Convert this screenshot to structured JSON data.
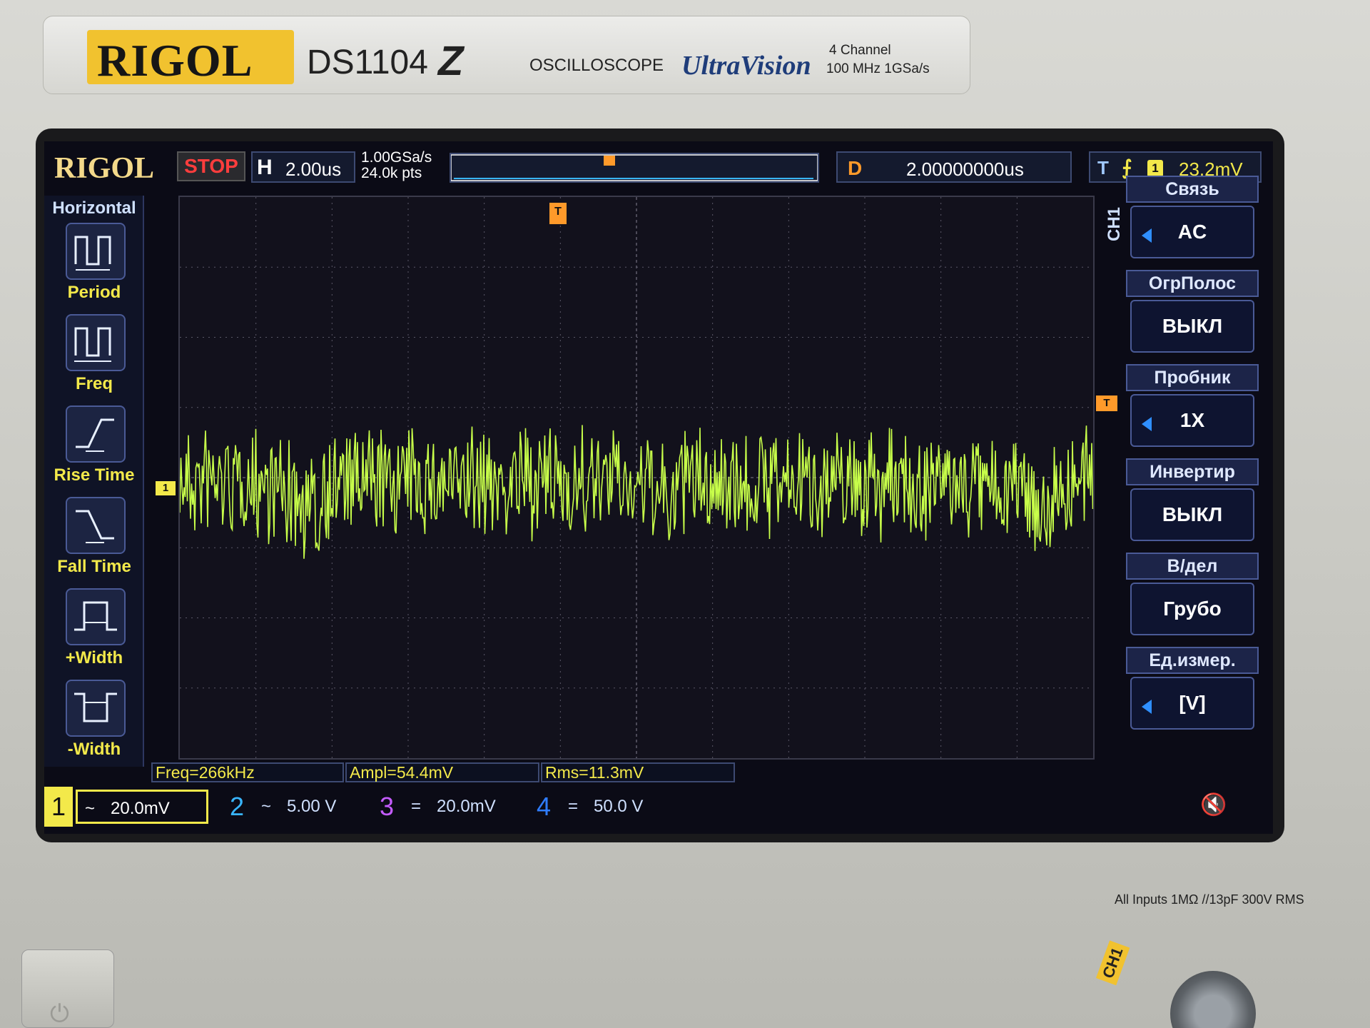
{
  "device": {
    "brand": "RIGOL",
    "model": "DS1104",
    "model_suffix": "Z",
    "type_label": "OSCILLOSCOPE",
    "series_logo": "UltraVision",
    "spec_line1": "4 Channel",
    "spec_line2": "100 MHz  1GSa/s",
    "inputs_rating": "All Inputs 1MΩ //13pF 300V RMS",
    "input_connector_label": "CH1"
  },
  "status": {
    "logo": "RIGOL",
    "run_state": "STOP",
    "horizontal_label": "H",
    "timebase": "2.00us",
    "sample_rate": "1.00GSa/s",
    "memory_depth": "24.0k pts",
    "delay_label": "D",
    "delay_value": "2.00000000us",
    "trigger_label": "T",
    "trigger_slope_icon": "rising-edge-icon",
    "trigger_channel": "1",
    "trigger_level": "23.2mV"
  },
  "left_menu": {
    "title": "Horizontal",
    "items": [
      {
        "label": "Period",
        "icon": "period-icon"
      },
      {
        "label": "Freq",
        "icon": "frequency-icon"
      },
      {
        "label": "Rise Time",
        "icon": "rise-time-icon"
      },
      {
        "label": "Fall Time",
        "icon": "fall-time-icon"
      },
      {
        "label": "+Width",
        "icon": "positive-width-icon"
      },
      {
        "label": "-Width",
        "icon": "negative-width-icon"
      }
    ]
  },
  "markers": {
    "channel_ground": "1",
    "trigger_position": "T",
    "trigger_level": "T"
  },
  "right_menu": {
    "channel_label": "CH1",
    "items": [
      {
        "title": "Связь",
        "value": "AC"
      },
      {
        "title": "ОгрПолос",
        "value": "ВЫКЛ"
      },
      {
        "title": "Пробник",
        "value": "1X"
      },
      {
        "title": "Инвертир",
        "value": "ВЫКЛ"
      },
      {
        "title": "В/дел",
        "value": "Грубо"
      },
      {
        "title": "Ед.измер.",
        "value": "[V]"
      }
    ]
  },
  "measurements": [
    {
      "text": "Freq=266kHz"
    },
    {
      "text": "Ampl=54.4mV"
    },
    {
      "text": "Rms=11.3mV"
    }
  ],
  "channels": [
    {
      "number": "1",
      "coupling": "~",
      "scale": "20.0mV",
      "color": "#f3e94a"
    },
    {
      "number": "2",
      "coupling": "~",
      "scale": "5.00 V",
      "color": "#39b6ff"
    },
    {
      "number": "3",
      "coupling": "=",
      "scale": "20.0mV",
      "color": "#c45cff"
    },
    {
      "number": "4",
      "coupling": "=",
      "scale": "50.0 V",
      "color": "#2f7dff"
    }
  ],
  "speaker_icon": "speaker-muted-icon",
  "colors": {
    "trace": "#c8ff4a",
    "grid": "#5a5868",
    "accent": "#f3e94a",
    "trigger": "#ff9a2a"
  }
}
